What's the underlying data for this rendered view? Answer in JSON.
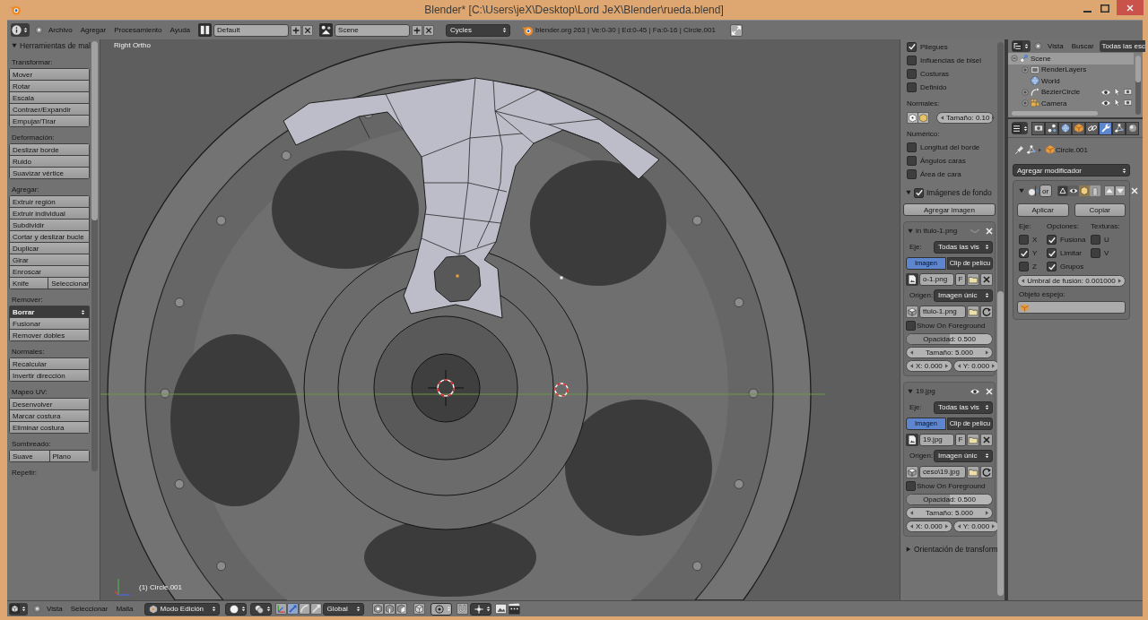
{
  "window": {
    "title": "Blender* [C:\\Users\\jeX\\Desktop\\Lord JeX\\Blender\\rueda.blend]"
  },
  "info_header": {
    "menus": [
      "Archivo",
      "Agregar",
      "Procesamiento",
      "Ayuda"
    ],
    "screen_layout": "Default",
    "scene": "Scene",
    "render_engine": "Cycles",
    "stats": "blender.org 263 | Ve:0-30 | Ed:0-45 | Fa:0-16 | Circle.001"
  },
  "tool_shelf": {
    "title": "Herramientas de mal",
    "expanded": true,
    "sections": [
      {
        "label": "Transformar:",
        "rows": [
          {
            "kind": "button",
            "labels": [
              "Mover"
            ]
          },
          {
            "kind": "button",
            "labels": [
              "Rotar"
            ]
          },
          {
            "kind": "button",
            "labels": [
              "Escala"
            ]
          },
          {
            "kind": "button",
            "labels": [
              "Contraer/Expandir"
            ]
          },
          {
            "kind": "button",
            "labels": [
              "Empujar/Tirar"
            ]
          }
        ]
      },
      {
        "label": "Deformación:",
        "rows": [
          {
            "kind": "button",
            "labels": [
              "Deslizar borde"
            ]
          },
          {
            "kind": "button",
            "labels": [
              "Ruido"
            ]
          },
          {
            "kind": "button",
            "labels": [
              "Suavizar vértice"
            ]
          }
        ]
      },
      {
        "label": "Agregar:",
        "rows": [
          {
            "kind": "button",
            "labels": [
              "Extruir región"
            ]
          },
          {
            "kind": "button",
            "labels": [
              "Extruir individual"
            ]
          },
          {
            "kind": "button",
            "labels": [
              "Subdividir"
            ]
          },
          {
            "kind": "button",
            "labels": [
              "Cortar y deslizar bucle"
            ]
          },
          {
            "kind": "button",
            "labels": [
              "Duplicar"
            ]
          },
          {
            "kind": "button",
            "labels": [
              "Girar"
            ]
          },
          {
            "kind": "button",
            "labels": [
              "Enroscar"
            ]
          },
          {
            "kind": "button",
            "labels": [
              "Knife",
              "Seleccionar"
            ]
          }
        ]
      },
      {
        "label": "Remover:",
        "rows": [
          {
            "kind": "dropdown",
            "labels": [
              "Borrar"
            ]
          },
          {
            "kind": "button",
            "labels": [
              "Fusionar"
            ]
          },
          {
            "kind": "button",
            "labels": [
              "Remover dobles"
            ]
          }
        ]
      },
      {
        "label": "Normales:",
        "rows": [
          {
            "kind": "button",
            "labels": [
              "Recalcular"
            ]
          },
          {
            "kind": "button",
            "labels": [
              "Invertir dirección"
            ]
          }
        ]
      },
      {
        "label": "Mapeo UV:",
        "rows": [
          {
            "kind": "button",
            "labels": [
              "Desenvolver"
            ]
          },
          {
            "kind": "button",
            "labels": [
              "Marcar costura"
            ]
          },
          {
            "kind": "button",
            "labels": [
              "Eliminar costura"
            ]
          }
        ]
      },
      {
        "label": "Sombreado:",
        "rows": [
          {
            "kind": "button",
            "labels": [
              "Suave",
              "Plano"
            ]
          }
        ]
      },
      {
        "label": "Repetir:"
      }
    ]
  },
  "viewport": {
    "view_name": "Right Ortho",
    "object_name": "(1) Circle.001"
  },
  "n_panel": {
    "mesh_display": {
      "rows": [
        {
          "kind": "checkbox",
          "label": "Pliegues",
          "checked": true
        },
        {
          "kind": "checkbox",
          "label": "Influencias de bisel",
          "checked": false
        },
        {
          "kind": "checkbox",
          "label": "Costuras",
          "checked": false
        },
        {
          "kind": "checkbox",
          "label": "Definido",
          "checked": false
        },
        {
          "kind": "heading",
          "label": "Normales:"
        },
        {
          "kind": "normals",
          "value": "Tamaño: 0.10"
        },
        {
          "kind": "heading",
          "label": "Numérico:"
        },
        {
          "kind": "checkbox",
          "label": "Longitud del borde",
          "checked": false
        },
        {
          "kind": "checkbox",
          "label": "Ángulos caras",
          "checked": false
        },
        {
          "kind": "checkbox",
          "label": "Área de cara",
          "checked": false
        }
      ]
    },
    "background_images": {
      "title": "Imágenes de fondo",
      "expanded": true,
      "enabled": true,
      "add_button": "Agregar imagen",
      "images": [
        {
          "name": "in ttulo-1.png",
          "expanded": true,
          "visible": false,
          "axis_label": "Eje:",
          "axis": "Todas las vis",
          "tabs": [
            {
              "label": "Imagen",
              "selected": true
            },
            {
              "label": "Clip de pelícu",
              "selected": false
            }
          ],
          "image": "o-1.png",
          "fake_user": "F",
          "source_label": "Origen:",
          "source": "Imagen únic",
          "filepath": "ttulo-1.png",
          "foreground": {
            "label": "Show On Foreground",
            "checked": false
          },
          "opacity": {
            "label": "Opacidad: 0.500",
            "level": 0.5
          },
          "size": "Tamaño: 5.000",
          "offset_x": "X: 0.000",
          "offset_y": "Y: 0.000"
        },
        {
          "name": "19.jpg",
          "expanded": true,
          "visible": true,
          "axis_label": "Eje:",
          "axis": "Todas las vis",
          "tabs": [
            {
              "label": "Imagen",
              "selected": true
            },
            {
              "label": "Clip de pelícu",
              "selected": false
            }
          ],
          "image": "19.jpg",
          "fake_user": "F",
          "source_label": "Origen:",
          "source": "Imagen únic",
          "filepath": "ceso\\19.jpg",
          "foreground": {
            "label": "Show On Foreground",
            "checked": false
          },
          "opacity": {
            "label": "Opacidad: 0.500",
            "level": 0.5
          },
          "size": "Tamaño: 5.000",
          "offset_x": "X: 0.000",
          "offset_y": "Y: 0.000"
        }
      ]
    },
    "transform_orientation": {
      "title": "Orientación de transform",
      "expanded": false
    }
  },
  "outliner": {
    "menus": [
      "Vista",
      "Buscar"
    ],
    "filter": "Todas las esc",
    "tree": [
      {
        "label": "Scene",
        "kind": "scene",
        "expanded": true,
        "selected": true,
        "children": [
          {
            "label": "RenderLayers",
            "kind": "render_layers",
            "selected": false
          },
          {
            "label": "World",
            "kind": "world",
            "selected": false
          },
          {
            "label": "BezierCircle",
            "kind": "curve",
            "selected": false
          },
          {
            "label": "Camera",
            "kind": "camera",
            "selected": false
          }
        ]
      }
    ]
  },
  "properties": {
    "tabs": [
      {
        "kind": "render",
        "selected": false
      },
      {
        "kind": "scene",
        "selected": false
      },
      {
        "kind": "world",
        "selected": false
      },
      {
        "kind": "object",
        "selected": false
      },
      {
        "kind": "constraints",
        "selected": false
      },
      {
        "kind": "modifiers",
        "selected": true
      },
      {
        "kind": "data",
        "selected": false
      },
      {
        "kind": "material",
        "selected": false
      }
    ],
    "context": "Circle.001",
    "add_modifier": "Agregar modificador",
    "modifier": {
      "expanded": true,
      "name": "or",
      "apply": "Aplicar",
      "copy": "Copiar",
      "columns": [
        {
          "label": "Eje:",
          "options": [
            {
              "label": "X",
              "checked": false
            },
            {
              "label": "Y",
              "checked": true
            },
            {
              "label": "Z",
              "checked": false
            }
          ]
        },
        {
          "label": "Opciones:",
          "options": [
            {
              "label": "Fusiona",
              "checked": true
            },
            {
              "label": "Limitar",
              "checked": true
            },
            {
              "label": "Grupos",
              "checked": true
            }
          ]
        },
        {
          "label": "Texturas:",
          "options": [
            {
              "label": "U",
              "checked": false
            },
            {
              "label": "V",
              "checked": false
            }
          ]
        }
      ],
      "merge_limit": "Umbral de fusión: 0.001000",
      "mirror_object_label": "Objeto espejo:"
    }
  },
  "view3d_header": {
    "menus": [
      "Vista",
      "Seleccionar",
      "Malla"
    ],
    "mode": "Modo Edición",
    "orientation": "Global"
  }
}
